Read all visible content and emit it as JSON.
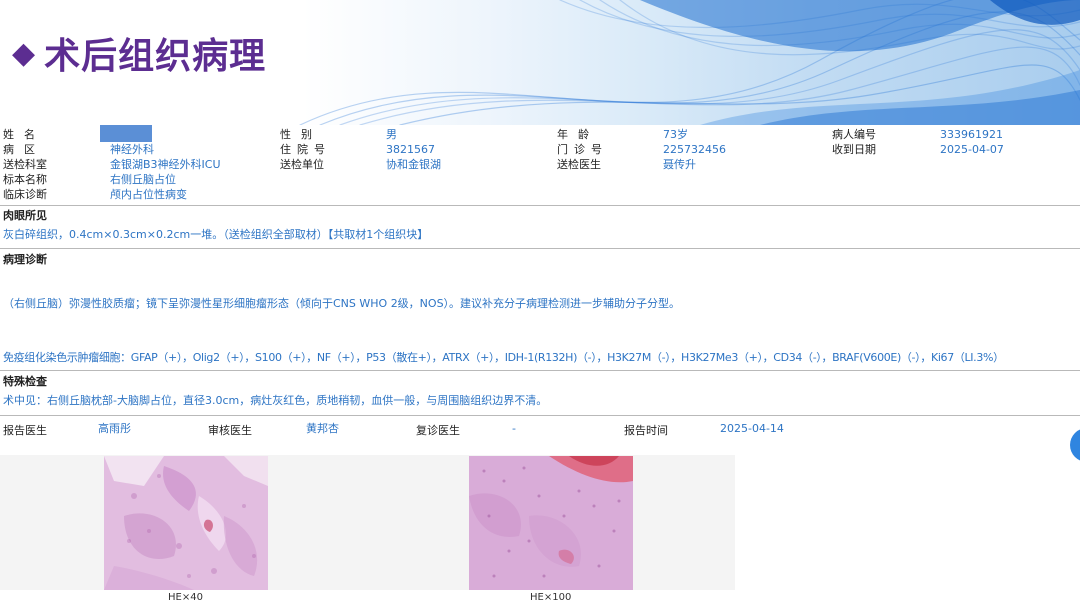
{
  "banner": {
    "title": "术后组织病理"
  },
  "patient": {
    "name_label": "姓名",
    "name_value": "",
    "gender_label": "性别",
    "gender_value": "男",
    "age_label": "年龄",
    "age_value": "73岁",
    "patient_id_label": "病人编号",
    "patient_id_value": "333961921",
    "ward_label": "病区",
    "ward_value": "神经外科",
    "admission_label": "住院号",
    "admission_value": "3821567",
    "outpatient_label": "门诊号",
    "outpatient_value": "225732456",
    "received_label": "收到日期",
    "received_value": "2025-04-07",
    "dept_label": "送检科室",
    "dept_value": "金银湖B3神经外科ICU",
    "unit_label": "送检单位",
    "unit_value": "协和金银湖",
    "doctor_label": "送检医生",
    "doctor_value": "聂传升",
    "specimen_label": "标本名称",
    "specimen_value": "右侧丘脑占位",
    "clinical_label": "临床诊断",
    "clinical_value": "颅内占位性病变"
  },
  "gross": {
    "heading": "肉眼所见",
    "text": "灰白碎组织，0.4cm×0.3cm×0.2cm一堆。（送检组织全部取材）【共取材1个组织块】"
  },
  "diagnosis": {
    "heading": "病理诊断",
    "text": "（右侧丘脑）弥漫性胶质瘤；镜下呈弥漫性星形细胞瘤形态（倾向于CNS WHO 2级，NOS）。建议补充分子病理检测进一步辅助分子分型。",
    "ihc": "免疫组化染色示肿瘤细胞：GFAP（+），Olig2（+），S100（+），NF（+），P53（散在+），ATRX（+），IDH-1(R132H)（-），H3K27M（-），H3K27Me3（+），CD34（-），BRAF(V600E)（-），Ki67（LI.3%）"
  },
  "special": {
    "heading": "特殊检查",
    "text": "术中见：右侧丘脑枕部-大脑脚占位，直径3.0cm，病灶灰红色，质地稍韧，血供一般，与周围脑组织边界不清。"
  },
  "report": {
    "report_doctor_label": "报告医生",
    "report_doctor_value": "高雨彤",
    "review_doctor_label": "审核医生",
    "review_doctor_value": "黄邦杏",
    "recheck_doctor_label": "复诊医生",
    "recheck_doctor_value": "-",
    "report_time_label": "报告时间",
    "report_time_value": "2025-04-14"
  },
  "images": [
    {
      "caption": "HE×40"
    },
    {
      "caption": "HE×100"
    }
  ],
  "colors": {
    "title": "#5c2d91",
    "value": "#2d74c4",
    "banner_wave": "#2a78d6"
  }
}
